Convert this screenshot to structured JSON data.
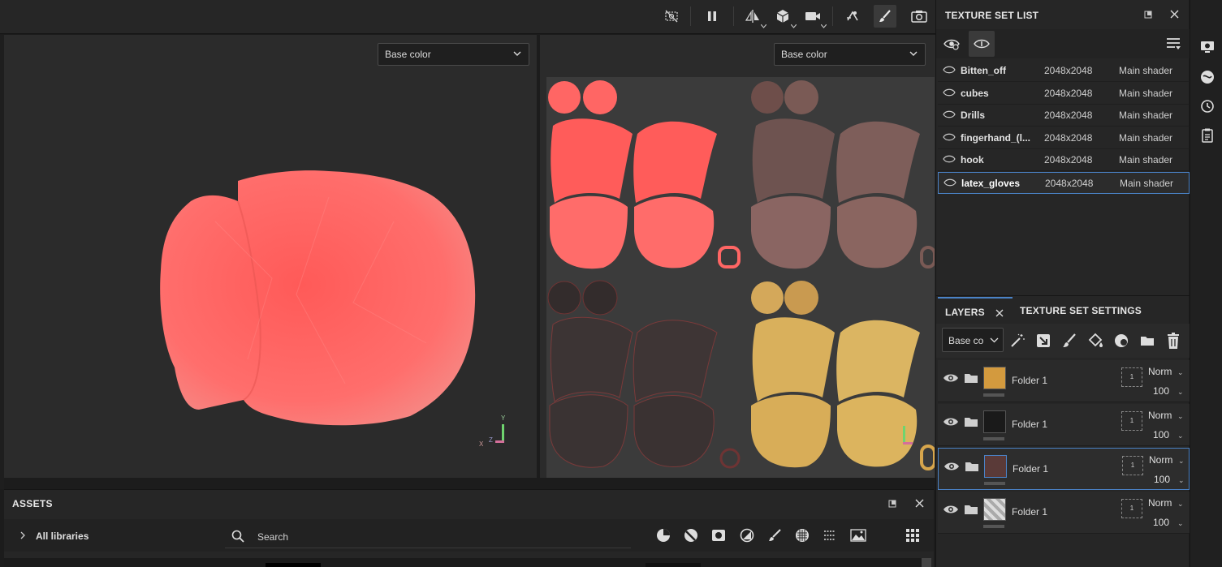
{
  "toolbar": {
    "icons": [
      "camera-off-icon",
      "pause-icon",
      "symmetry-icon",
      "cube-icon",
      "video-camera-icon",
      "bake-icon",
      "brush-icon",
      "screenshot-icon"
    ]
  },
  "viewport3d": {
    "channel": "Base color",
    "axis": {
      "y": "Y",
      "x": "X",
      "z": "Z"
    }
  },
  "viewport2d": {
    "channel": "Base color"
  },
  "texture_set_list": {
    "title": "TEXTURE SET LIST",
    "sets": [
      {
        "name": "Bitten_off",
        "resolution": "2048x2048",
        "shader": "Main shader"
      },
      {
        "name": "cubes",
        "resolution": "2048x2048",
        "shader": "Main shader"
      },
      {
        "name": "Drills",
        "resolution": "2048x2048",
        "shader": "Main shader"
      },
      {
        "name": "fingerhand_(l...",
        "resolution": "2048x2048",
        "shader": "Main shader"
      },
      {
        "name": "hook",
        "resolution": "2048x2048",
        "shader": "Main shader"
      },
      {
        "name": "latex_gloves",
        "resolution": "2048x2048",
        "shader": "Main shader"
      }
    ]
  },
  "layers_panel": {
    "tab_layers": "LAYERS",
    "tab_settings": "TEXTURE SET SETTINGS",
    "channel_select": "Base co",
    "layers": [
      {
        "name": "Folder 1",
        "blend": "Norm",
        "opacity": "100",
        "mask_count": "1"
      },
      {
        "name": "Folder 1",
        "blend": "Norm",
        "opacity": "100",
        "mask_count": "1"
      },
      {
        "name": "Folder 1",
        "blend": "Norm",
        "opacity": "100",
        "mask_count": "1"
      },
      {
        "name": "Folder 1",
        "blend": "Norm",
        "opacity": "100",
        "mask_count": "1"
      }
    ]
  },
  "assets": {
    "title": "ASSETS",
    "library": "All libraries",
    "search_placeholder": "Search"
  },
  "colors": {
    "accent": "#4a82c6",
    "glove_red": "#ff6a68",
    "glove_brown": "#8a6560",
    "glove_dark": "#3c3434",
    "glove_gold": "#d8b05e"
  }
}
